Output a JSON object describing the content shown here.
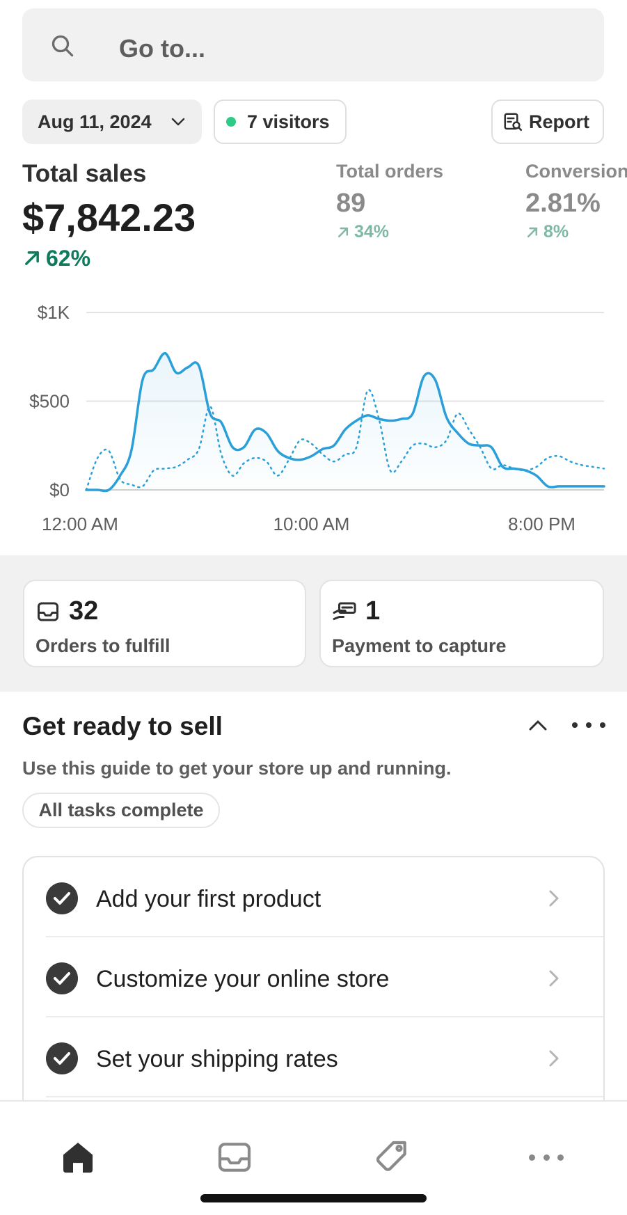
{
  "search": {
    "placeholder": "Go to..."
  },
  "filters": {
    "date": "Aug 11, 2024",
    "visitors": "7 visitors",
    "report": "Report"
  },
  "metrics": {
    "total_sales": {
      "label": "Total sales",
      "value": "$7,842.23",
      "change": "62%"
    },
    "total_orders": {
      "label": "Total orders",
      "value": "89",
      "change": "34%"
    },
    "conversion": {
      "label": "Conversion",
      "value": "2.81%",
      "change": "8%"
    }
  },
  "chart_data": {
    "type": "line",
    "y_ticks": [
      "$1K",
      "$500",
      "$0"
    ],
    "x_ticks": [
      "12:00 AM",
      "10:00 AM",
      "8:00 PM"
    ],
    "ylim": [
      0,
      1000
    ],
    "xlim": [
      0,
      23
    ],
    "grid": true,
    "series": [
      {
        "style": "solid",
        "color": "#2a9fd8",
        "x": [
          0,
          0.5,
          1,
          1.5,
          2,
          2.5,
          3,
          3.5,
          4,
          4.5,
          5,
          5.5,
          6,
          6.5,
          7,
          7.5,
          8,
          8.5,
          9,
          9.5,
          10,
          10.5,
          11,
          11.5,
          12,
          12.5,
          13,
          13.5,
          14,
          14.5,
          15,
          15.5,
          16,
          16.5,
          17,
          17.5,
          18,
          18.5,
          19,
          19.5,
          20,
          20.5,
          21,
          21.5,
          22,
          22.5,
          23
        ],
        "values": [
          0,
          0,
          0,
          80,
          220,
          620,
          680,
          770,
          660,
          690,
          700,
          430,
          380,
          240,
          240,
          340,
          320,
          220,
          180,
          170,
          190,
          230,
          250,
          340,
          390,
          420,
          400,
          390,
          400,
          430,
          640,
          620,
          410,
          320,
          260,
          250,
          240,
          130,
          120,
          110,
          80,
          20,
          20,
          20,
          20,
          20,
          20
        ]
      },
      {
        "style": "dotted",
        "color": "#2a9fd8",
        "x": [
          0,
          0.5,
          1,
          1.5,
          2,
          2.5,
          3,
          3.5,
          4,
          4.5,
          5,
          5.5,
          6,
          6.5,
          7,
          7.5,
          8,
          8.5,
          9,
          9.5,
          10,
          10.5,
          11,
          11.5,
          12,
          12.5,
          13,
          13.5,
          14,
          14.5,
          15,
          15.5,
          16,
          16.5,
          17,
          17.5,
          18,
          18.5,
          19,
          19.5,
          20,
          20.5,
          21,
          21.5,
          22,
          22.5,
          23
        ],
        "values": [
          0,
          180,
          220,
          60,
          30,
          20,
          110,
          120,
          130,
          170,
          230,
          470,
          200,
          80,
          150,
          180,
          160,
          80,
          170,
          280,
          260,
          200,
          160,
          200,
          240,
          560,
          400,
          110,
          160,
          250,
          260,
          240,
          280,
          430,
          340,
          240,
          120,
          140,
          120,
          110,
          130,
          180,
          190,
          160,
          140,
          130,
          120
        ]
      }
    ]
  },
  "quick_cards": [
    {
      "value": "32",
      "label": "Orders to fulfill",
      "icon": "inbox-icon"
    },
    {
      "value": "1",
      "label": "Payment to capture",
      "icon": "payment-hand-icon"
    }
  ],
  "guide": {
    "title": "Get ready to sell",
    "subtitle": "Use this guide to get your store up and running.",
    "status": "All tasks complete",
    "tasks": [
      {
        "label": "Add your first product"
      },
      {
        "label": "Customize your online store"
      },
      {
        "label": "Set your shipping rates"
      }
    ]
  },
  "bottom_nav": [
    "home-icon",
    "orders-icon",
    "products-tag-icon",
    "more-icon"
  ],
  "colors": {
    "accent_line": "#2a9fd8",
    "positive": "#0f7b5c",
    "live_dot": "#2ecb86"
  }
}
